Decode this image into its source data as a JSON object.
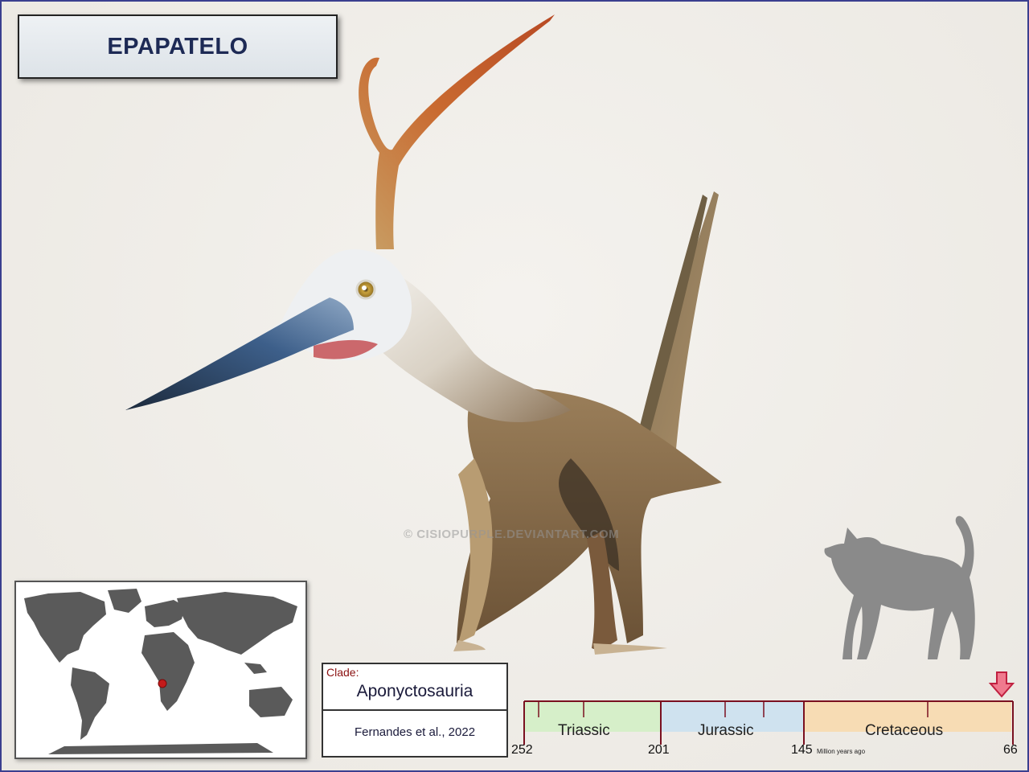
{
  "title": "EPAPATELO",
  "watermark": "© CISIOPURPLE.DEVIANTART.COM",
  "clade": {
    "label": "Clade:",
    "name": "Aponyctosauria",
    "reference": "Fernandes et al., 2022"
  },
  "timeline": {
    "periods": [
      {
        "name": "Triassic",
        "color": "#d6efc9"
      },
      {
        "name": "Jurassic",
        "color": "#cfe2ef"
      },
      {
        "name": "Cretaceous",
        "color": "#f7dcb4"
      }
    ],
    "ticks": [
      "252",
      "201",
      "145",
      "66"
    ],
    "unit_label": "Million years ago",
    "marker_color": "#e0607a"
  },
  "map": {
    "land_color": "#5a5a5a",
    "locality_color": "#c41a1a"
  },
  "icons": {
    "map": "world-map-icon",
    "silhouette": "cat-silhouette-icon",
    "arrow": "arrow-down-icon"
  }
}
